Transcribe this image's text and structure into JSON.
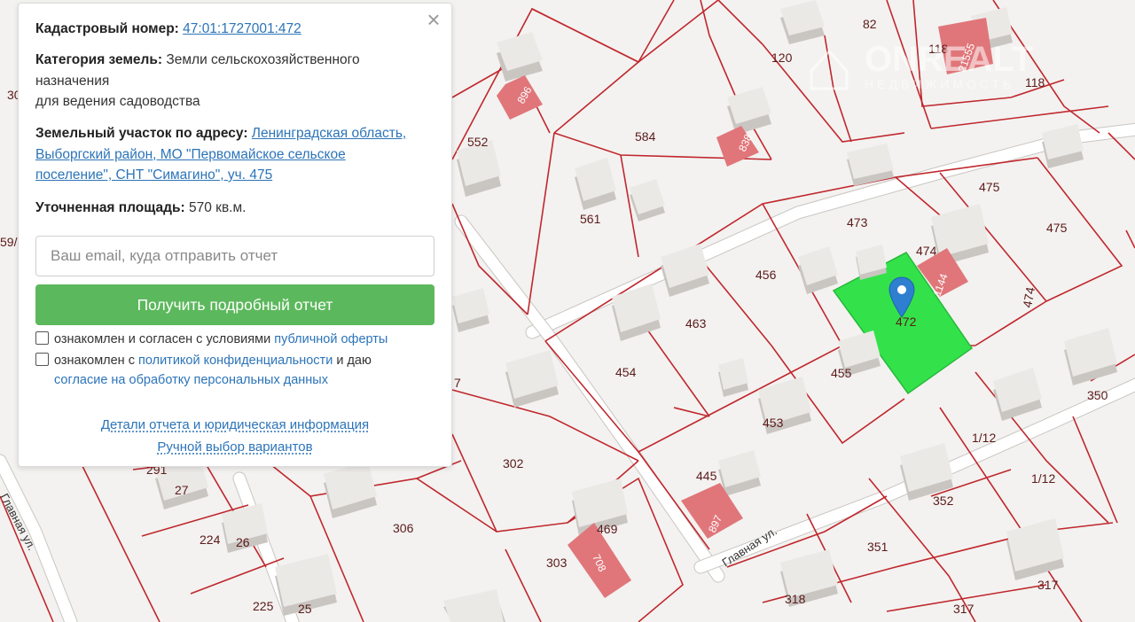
{
  "panel": {
    "cadastral_label": "Кадастровый номер:",
    "cadastral_number": "47:01:1727001:472",
    "category_label": "Категория земель:",
    "category_value": "Земли сельскохозяйственного назначения",
    "category_use": "для ведения садоводства",
    "address_label": "Земельный участок по адресу:",
    "address_value": "Ленинградская область, Выборгский район, МО \"Первомайское сельское поселение\", СНТ \"Симагино\", уч. 475",
    "area_label": "Уточненная площадь:",
    "area_value": "570 кв.м.",
    "close_symbol": "×",
    "email_placeholder": "Ваш email, куда отправить отчет",
    "submit_label": "Получить подробный отчет",
    "offer_text": "ознакомлен и согласен с условиями",
    "offer_link": "публичной оферты",
    "privacy_text": "ознакомлен с",
    "privacy_link": "политикой конфиденциальности",
    "privacy_text2": "и даю",
    "consent_link": "согласие на обработку персональных данных",
    "details_link": "Детали отчета и юридическая информация",
    "manual_link": "Ручной выбор вариантов"
  },
  "map": {
    "parcel_labels": {
      "p30": "30",
      "p59": "59/",
      "p291": "291",
      "p27": "27",
      "p224": "224",
      "p26": "26",
      "p225": "225",
      "p25": "25",
      "p7": "7",
      "p302": "302",
      "p306": "306",
      "p303": "303",
      "p469": "469",
      "p552": "552",
      "p584": "584",
      "p561": "561",
      "p120": "120",
      "p82": "82",
      "p118a": "118",
      "p118b": "118",
      "p473": "473",
      "p475a": "475",
      "p475b": "475",
      "p474a": "474",
      "p474b": "474",
      "p456": "456",
      "p463": "463",
      "p454": "454",
      "p455": "455",
      "p472": "472",
      "p453": "453",
      "p445": "445",
      "p350": "350",
      "p112a": "1/12",
      "p112b": "1/12",
      "p352": "352",
      "p351": "351",
      "p318": "318",
      "p317a": "317",
      "p317b": "317"
    },
    "building_labels": {
      "b896": "896",
      "b838": "838",
      "b21555": "21555",
      "b1144": "1144",
      "b897": "897",
      "b708": "708"
    },
    "street_main": "Главная ул.",
    "street_left": "Главная ул.",
    "watermark_brand": "ONREALT",
    "watermark_sub": "НЕДВИЖИМОСТЬ",
    "colors": {
      "parcel_line": "#c0272d",
      "selected_parcel": "#33e24a",
      "pin": "#2f7fd1",
      "owned_building": "#e0767a"
    }
  }
}
